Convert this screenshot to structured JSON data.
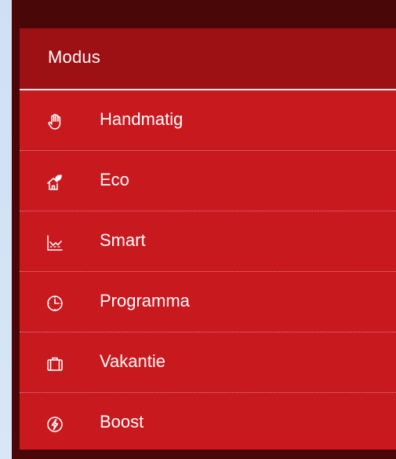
{
  "menu": {
    "title": "Modus",
    "items": [
      {
        "label": "Handmatig",
        "icon": "hand-icon"
      },
      {
        "label": "Eco",
        "icon": "eco-house-icon"
      },
      {
        "label": "Smart",
        "icon": "chart-icon"
      },
      {
        "label": "Programma",
        "icon": "clock-icon"
      },
      {
        "label": "Vakantie",
        "icon": "suitcase-icon"
      },
      {
        "label": "Boost",
        "icon": "lightning-icon"
      }
    ]
  },
  "colors": {
    "panel": "#c8191f",
    "header": "#9d1014",
    "frame": "#4a0707",
    "text": "#ffffff"
  }
}
